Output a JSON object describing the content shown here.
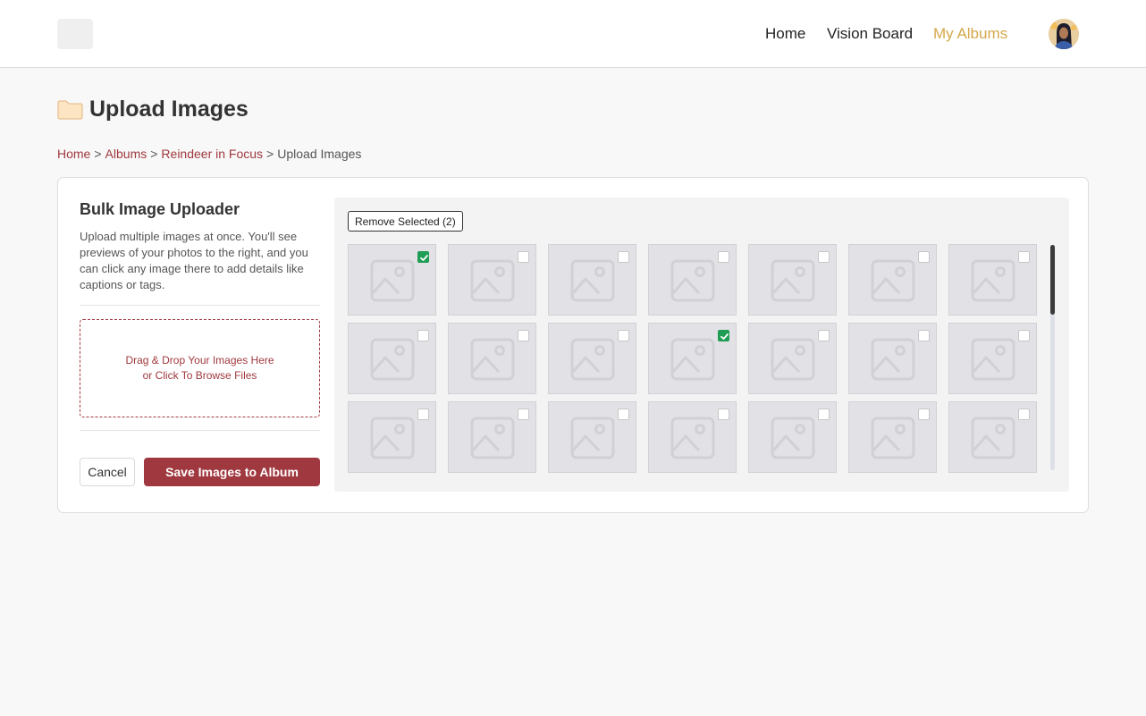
{
  "nav": {
    "items": [
      {
        "label": "Home",
        "active": false
      },
      {
        "label": "Vision Board",
        "active": false
      },
      {
        "label": "My Albums",
        "active": true
      }
    ]
  },
  "page": {
    "title": "Upload Images"
  },
  "breadcrumb": {
    "links": [
      "Home",
      "Albums",
      "Reindeer in Focus"
    ],
    "current": "Upload Images",
    "separator": ">"
  },
  "uploader": {
    "heading": "Bulk Image Uploader",
    "description": "Upload multiple images at once. You'll see previews of your photos to the right, and you can click any image there to add details like captions or tags.",
    "dropzone_line1": "Drag & Drop Your Images Here",
    "dropzone_line2": "or Click To Browse Files",
    "cancel_label": "Cancel",
    "save_label": "Save Images to Album"
  },
  "gallery": {
    "remove_label": "Remove Selected (2)",
    "columns": 7,
    "images": [
      {
        "selected": true
      },
      {
        "selected": false
      },
      {
        "selected": false
      },
      {
        "selected": false
      },
      {
        "selected": false
      },
      {
        "selected": false
      },
      {
        "selected": false
      },
      {
        "selected": false
      },
      {
        "selected": false
      },
      {
        "selected": false
      },
      {
        "selected": true
      },
      {
        "selected": false
      },
      {
        "selected": false
      },
      {
        "selected": false
      },
      {
        "selected": false
      },
      {
        "selected": false
      },
      {
        "selected": false
      },
      {
        "selected": false
      },
      {
        "selected": false
      },
      {
        "selected": false
      },
      {
        "selected": false
      }
    ]
  },
  "colors": {
    "accent": "#a0393f",
    "nav_active": "#d4a84a",
    "checkbox_selected": "#1f9d55"
  }
}
